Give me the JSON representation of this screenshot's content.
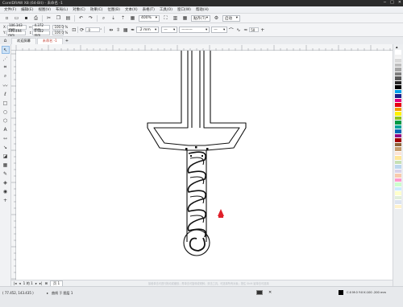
{
  "title": "CorelDRAW X8 (64-Bit) - 未命名 -1",
  "window_controls": [
    "─",
    "□",
    "✕"
  ],
  "menu": [
    "文件(F)",
    "编辑(E)",
    "视图(V)",
    "布局(L)",
    "对象(C)",
    "效果(C)",
    "位图(B)",
    "文本(X)",
    "表格(T)",
    "工具(O)",
    "窗口(W)",
    "帮助(H)"
  ],
  "standard": {
    "zoom": "400%",
    "snap_label": "贴齐(T)",
    "launch_label": "启动"
  },
  "props": {
    "x": "106.343 mm",
    "y": "106.494 mm",
    "w": "4.372 mm",
    "h": "1.522 mm",
    "sx": "100.0",
    "sy": "100.0",
    "pct": "%",
    "angle": ".0",
    "deg": "°",
    "outline": ".2 mm",
    "ratio": "50"
  },
  "tabs": [
    {
      "label": "欢迎屏幕",
      "active": false
    },
    {
      "label": "未命名 -1",
      "active": true
    }
  ],
  "docnav": {
    "page_info": "1 的 1",
    "page_tab": "页 1"
  },
  "status": {
    "coords": "( 77.452, 143.435 )",
    "object_info": "曲线 于 图层 1",
    "color_info": "C:0 M:0 Y:0 K:100 .200 mm",
    "hint": "接着单击可进行拖动或缩放；再单击可旋转或倾斜；双击工具，可选择所有对象；按住 Shift 键单击可选择多个对象"
  },
  "colors": {
    "accent": "#c0392b",
    "marker": "#e0202a",
    "palette": [
      "#ffffff",
      "#f2f2f2",
      "#d9d9d9",
      "#bfbfbf",
      "#a6a6a6",
      "#7f7f7f",
      "#595959",
      "#262626",
      "#000000",
      "#00a0e9",
      "#1d2088",
      "#e4007f",
      "#e60012",
      "#f39800",
      "#fff100",
      "#8fc31f",
      "#009944",
      "#00a29a",
      "#0068b7",
      "#920783",
      "#a40000",
      "#8c6239",
      "#c69c6d",
      "#fce4d6",
      "#ffe699",
      "#c6e0b4",
      "#bdd7ee",
      "#d9d2e9",
      "#f8cbad",
      "#ff99cc",
      "#ccffcc",
      "#ccecff",
      "#ffffcc",
      "#e2efda",
      "#dde4f0",
      "#fff2cc"
    ]
  }
}
